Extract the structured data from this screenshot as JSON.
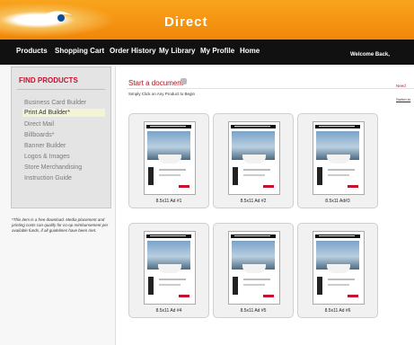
{
  "header": {
    "brand": "Direct",
    "nav": [
      "Products",
      "Shopping Cart",
      "Order History",
      "My Library",
      "My Profile",
      "Home"
    ],
    "welcome": "Welcome Back,"
  },
  "sidebar": {
    "title": "FIND PRODUCTS",
    "items": [
      {
        "label": "Business Card Builder"
      },
      {
        "label": "Print Ad Builder*"
      },
      {
        "label": "Direct Mail"
      },
      {
        "label": "Billboards*"
      },
      {
        "label": "Banner Builder"
      },
      {
        "label": "Logos & Images"
      },
      {
        "label": "Store Merchandising"
      },
      {
        "label": "Instruction Guide"
      }
    ],
    "note": "*This item is a free download. Media placement and printing costs can qualify for co-op reimbursement per available funds, if all guidelines have been met."
  },
  "main": {
    "title": "Start a document",
    "subtitle": "Simply Click on Any Product to Begin",
    "help_label": "Need",
    "switch_label": "Switch to",
    "products": [
      {
        "label": "8.5x11 Ad #1"
      },
      {
        "label": "8.5x11 Ad #2"
      },
      {
        "label": "8.5x11 Ad#3"
      },
      {
        "label": "8.5x11 Ad #4"
      },
      {
        "label": "8.5x11 Ad #5"
      },
      {
        "label": "8.5x11 Ad #6"
      }
    ]
  },
  "colors": {
    "accent": "#f39110",
    "nav_bg": "#111111",
    "heading_red": "#c8102e"
  }
}
